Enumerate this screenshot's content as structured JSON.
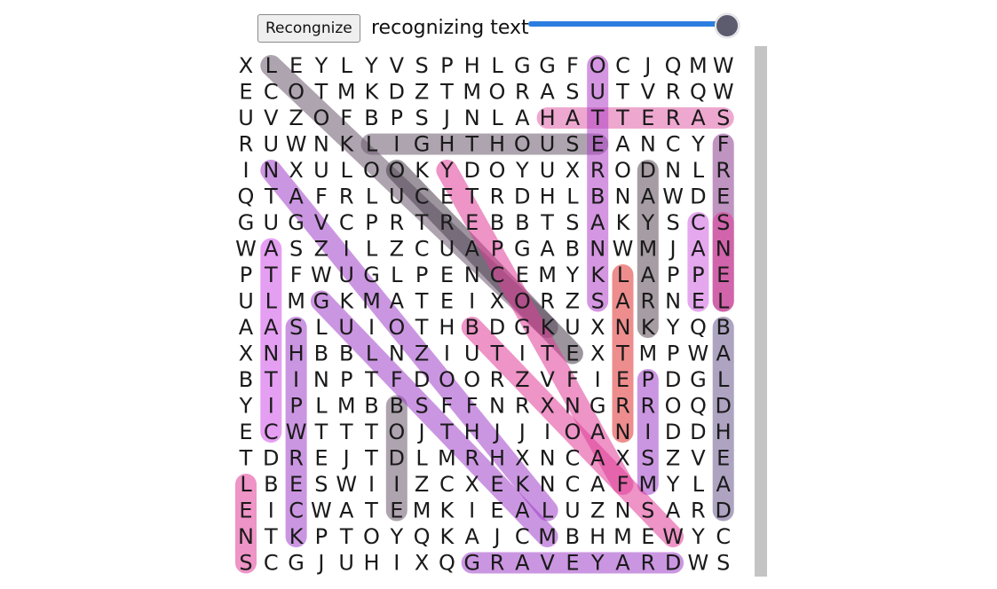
{
  "toolbar": {
    "recognize_label": "Recongnize",
    "status_text": "recognizing text",
    "progress": 1.0
  },
  "grid": [
    "XLEYLYVSPHLGGFOCJQMW",
    "ECOTMKDZTMORASUTVRQW",
    "UVZOFBPSJNLAHATTERAS",
    "RUWNKLIGHTHOUSEANCYF",
    "INXULOOKYDOYUXRODNLR",
    "QTAFRLUCETRDHLBNAWDE",
    "GUGVCPRTREBBTSAKYSCS",
    "WASZILZCUAPGABNWMJAN",
    "PTFWUGLPENCEMYKLAPPE",
    "ULMGKMATEIXORZSARNEL",
    "AASLUIOTHBDGKUXNKYQB",
    "XNHBBLNZIUTITEXTMPWA",
    "BTINPTFDOORZVFIEPDGL",
    "YIPLMBBSFFNRXNGRROQD",
    "ECWTTTOJTHJJIOANIDDH",
    "TDREJTDLMRHXNCAXSZVE",
    "LBESWIIZCXEKNCAFMYLA",
    "EICWATEMKIEALUZNSARD",
    "NTKPTOYQKAJCMBHMEWYC",
    "SCGJUHIXQGRAVEYARDWS"
  ],
  "highlights": [
    {
      "word": "HATTERAS",
      "r1": 2,
      "c1": 12,
      "r2": 2,
      "c2": 19,
      "color": "#e060a8"
    },
    {
      "word": "LIGHTHOUSE",
      "r1": 3,
      "c1": 5,
      "r2": 3,
      "c2": 14,
      "color": "#6b5a6e"
    },
    {
      "word": "OUTERBANKS",
      "r1": 0,
      "c1": 14,
      "r2": 9,
      "c2": 14,
      "color": "#b040c8"
    },
    {
      "word": "FRESNEL",
      "r1": 3,
      "c1": 19,
      "r2": 9,
      "c2": 19,
      "color": "#8a3c8e"
    },
    {
      "word": "SNEL",
      "r1": 6,
      "c1": 19,
      "r2": 9,
      "c2": 19,
      "color": "#e03c98"
    },
    {
      "word": "DAYMARK",
      "r1": 4,
      "c1": 16,
      "r2": 10,
      "c2": 16,
      "color": "#5c4a58"
    },
    {
      "word": "CAPE",
      "r1": 6,
      "c1": 18,
      "r2": 9,
      "c2": 18,
      "color": "#d060e0"
    },
    {
      "word": "LANTERN",
      "r1": 8,
      "c1": 15,
      "r2": 14,
      "c2": 15,
      "color": "#e03030"
    },
    {
      "word": "PRISM",
      "r1": 12,
      "c1": 16,
      "r2": 16,
      "c2": 16,
      "color": "#a040c8"
    },
    {
      "word": "BALDHEAD",
      "r1": 10,
      "c1": 19,
      "r2": 17,
      "c2": 19,
      "color": "#6b5a8e"
    },
    {
      "word": "ATLANTIC",
      "r1": 7,
      "c1": 1,
      "r2": 14,
      "c2": 1,
      "color": "#d050e8"
    },
    {
      "word": "SHIPWRECK",
      "r1": 10,
      "c1": 2,
      "r2": 18,
      "c2": 2,
      "color": "#a040c8"
    },
    {
      "word": "BODIE",
      "r1": 13,
      "c1": 6,
      "r2": 17,
      "c2": 6,
      "color": "#6b5a6e"
    },
    {
      "word": "LENS",
      "r1": 16,
      "c1": 0,
      "r2": 19,
      "c2": 0,
      "color": "#e03c98"
    },
    {
      "word": "GRAVEYARD",
      "r1": 19,
      "c1": 9,
      "r2": 19,
      "c2": 17,
      "color": "#a040c8"
    },
    {
      "word": "LOOKOUT",
      "r1": 0,
      "c1": 1,
      "r2": 10,
      "c2": 12,
      "color": "#6b5a6e"
    },
    {
      "word": "DIAG2",
      "r1": 4,
      "c1": 6,
      "r2": 11,
      "c2": 13,
      "color": "#4a3e4e"
    },
    {
      "word": "DIAG3",
      "r1": 4,
      "c1": 1,
      "r2": 17,
      "c2": 12,
      "color": "#a040c8"
    },
    {
      "word": "DIAG4",
      "r1": 9,
      "c1": 3,
      "r2": 18,
      "c2": 12,
      "color": "#a040c8"
    },
    {
      "word": "DIAG5",
      "r1": 4,
      "c1": 8,
      "r2": 16,
      "c2": 15,
      "color": "#e03c98"
    },
    {
      "word": "DIAG6",
      "r1": 10,
      "c1": 9,
      "r2": 18,
      "c2": 17,
      "color": "#e03c98"
    }
  ]
}
